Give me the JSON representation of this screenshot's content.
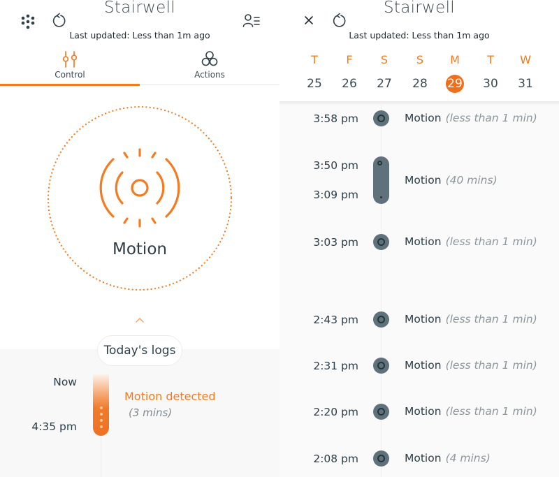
{
  "left": {
    "title": "Stairwell",
    "last_updated": "Last updated: Less than 1m ago",
    "header_icons": [
      "menu-dots-icon",
      "refresh-icon",
      "user-list-icon"
    ],
    "tabs": [
      {
        "label": "Control",
        "icon": "sliders-icon",
        "active": true
      },
      {
        "label": "Actions",
        "icon": "circles-icon",
        "active": false
      }
    ],
    "control": {
      "label": "Motion",
      "icon": "motion-sensor-icon"
    },
    "logs_button": "Today's logs",
    "live_log": {
      "start_label": "Now",
      "end_label": "4:35 pm",
      "title": "Motion detected",
      "duration": "(3 mins)"
    }
  },
  "right": {
    "title": "Stairwell",
    "last_updated": "Last updated: Less than 1m ago",
    "header_icons": [
      "close-icon",
      "refresh-icon"
    ],
    "week": [
      {
        "letter": "T",
        "day": "25",
        "selected": false
      },
      {
        "letter": "F",
        "day": "26",
        "selected": false
      },
      {
        "letter": "S",
        "day": "27",
        "selected": false
      },
      {
        "letter": "S",
        "day": "28",
        "selected": false
      },
      {
        "letter": "M",
        "day": "29",
        "selected": true
      },
      {
        "letter": "T",
        "day": "30",
        "selected": false
      },
      {
        "letter": "W",
        "day": "31",
        "selected": false
      }
    ],
    "events": [
      {
        "time": "3:58 pm",
        "label": "Motion",
        "duration": "(less than 1 min)"
      },
      {
        "time_start": "3:50 pm",
        "time_end": "3:09 pm",
        "label": "Motion",
        "duration": "(40 mins)"
      },
      {
        "time": "3:03 pm",
        "label": "Motion",
        "duration": "(less than 1 min)"
      },
      {
        "time": "2:43 pm",
        "label": "Motion",
        "duration": "(less than 1 min)"
      },
      {
        "time": "2:31 pm",
        "label": "Motion",
        "duration": "(less than 1 min)"
      },
      {
        "time": "2:20 pm",
        "label": "Motion",
        "duration": "(less than 1 min)"
      },
      {
        "time": "2:08 pm",
        "label": "Motion",
        "duration": "(4 mins)"
      }
    ]
  },
  "colors": {
    "accent": "#f47b20",
    "event_dot": "#5f727b",
    "text": "#2c3e48"
  }
}
